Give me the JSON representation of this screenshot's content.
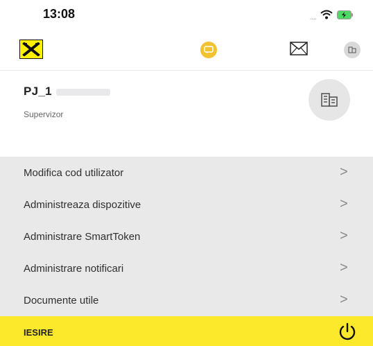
{
  "status_bar": {
    "time": "13:08",
    "signal_dots": "....",
    "wifi_icon": "wifi-icon",
    "battery_icon": "battery-charging-icon"
  },
  "top_bar": {
    "logo_icon": "raiffeisen-logo",
    "center_icon": "chat-badge-icon",
    "mail_icon": "mail-icon",
    "profile_icon": "company-icon",
    "colors": {
      "brand_yellow": "#fff200",
      "badge": "#f2c230"
    }
  },
  "user": {
    "name": "PJ_1",
    "role": "Supervizor",
    "avatar_icon": "company-building-icon"
  },
  "menu": {
    "items": [
      {
        "label": "Modifica cod utilizator",
        "chevron": ">"
      },
      {
        "label": "Administreaza dispozitive",
        "chevron": ">"
      },
      {
        "label": "Administrare SmartToken",
        "chevron": ">"
      },
      {
        "label": "Administrare notificari",
        "chevron": ">"
      },
      {
        "label": "Documente utile",
        "chevron": ">"
      }
    ],
    "background": "#e9e9e9"
  },
  "logout": {
    "label": "IESIRE",
    "icon": "power-icon",
    "background": "#fde92c"
  }
}
